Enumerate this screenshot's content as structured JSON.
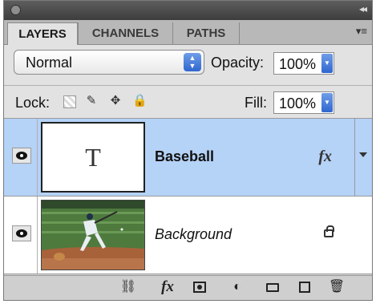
{
  "tabs": [
    {
      "label": "LAYERS"
    },
    {
      "label": "CHANNELS"
    },
    {
      "label": "PATHS"
    }
  ],
  "blend_mode": {
    "selected": "Normal"
  },
  "opacity": {
    "label": "Opacity:",
    "value": "100%"
  },
  "lock": {
    "label": "Lock:"
  },
  "fill": {
    "label": "Fill:",
    "value": "100%"
  },
  "layers": [
    {
      "name": "Baseball",
      "thumb_glyph": "T",
      "effects": "fx",
      "selected": true
    },
    {
      "name": "Background",
      "locked": true
    }
  ],
  "bottom_fx": "fx"
}
